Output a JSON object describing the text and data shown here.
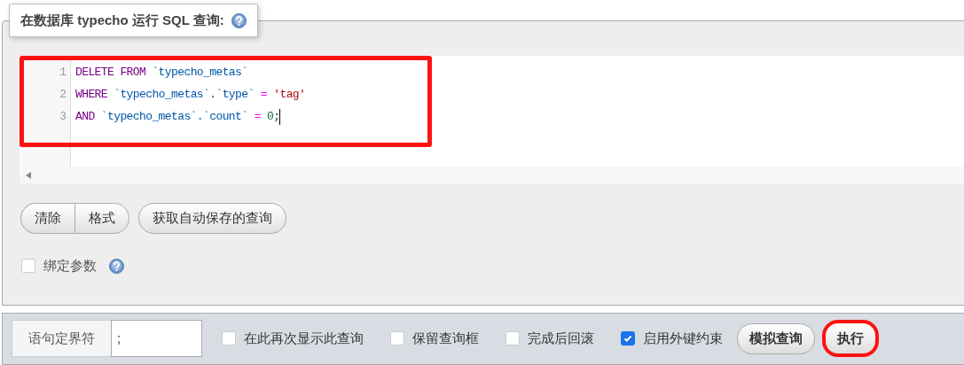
{
  "legend": {
    "text": "在数据库 typecho 运行 SQL 查询:"
  },
  "editor": {
    "annotated": true,
    "lines": [
      {
        "number": "1",
        "tokens": [
          {
            "kind": "keyword",
            "text": "DELETE FROM "
          },
          {
            "kind": "identifier",
            "text": "`typecho_metas`"
          }
        ]
      },
      {
        "number": "2",
        "tokens": [
          {
            "kind": "keyword",
            "text": "WHERE "
          },
          {
            "kind": "identifier",
            "text": "`typecho_metas`.`type` "
          },
          {
            "kind": "operator",
            "text": "= "
          },
          {
            "kind": "string",
            "text": "'tag'"
          }
        ]
      },
      {
        "number": "3",
        "tokens": [
          {
            "kind": "keyword",
            "text": "AND "
          },
          {
            "kind": "identifier",
            "text": "`typecho_metas`.`count` "
          },
          {
            "kind": "operator",
            "text": "= "
          },
          {
            "kind": "number",
            "text": "0"
          },
          {
            "kind": "punct",
            "text": ";"
          }
        ]
      }
    ]
  },
  "tool_button_groups": [
    {
      "buttons": [
        {
          "label": "清除"
        },
        {
          "label": "格式"
        }
      ]
    },
    {
      "buttons": [
        {
          "label": "获取自动保存的查询"
        }
      ]
    }
  ],
  "bind_params": {
    "label": "绑定参数",
    "checked": false
  },
  "footer": {
    "delimiter_label": "语句定界符",
    "delimiter_value": ";",
    "options": [
      {
        "label": "在此再次显示此查询",
        "checked": false
      },
      {
        "label": "保留查询框",
        "checked": false
      },
      {
        "label": "完成后回滚",
        "checked": false
      },
      {
        "label": "启用外键约束",
        "checked": true
      }
    ],
    "buttons": [
      {
        "label": "模拟查询",
        "annotated": false
      },
      {
        "label": "执行",
        "annotated": true
      }
    ]
  }
}
